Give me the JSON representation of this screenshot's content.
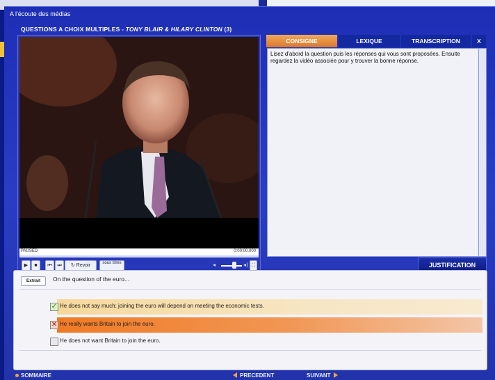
{
  "app": {
    "title": "A l'écoute des médias",
    "activity_type": "QUESTIONS A CHOIX MULTIPLES - ",
    "activity_topic": "TONY BLAIR & HILARY CLINTON",
    "activity_number": "(3)"
  },
  "video": {
    "status": "PAUSED",
    "time": "0:00:00.000",
    "progress": 0,
    "controls": {
      "replay_label": "Revoir",
      "subtitles_label": "sous titres"
    }
  },
  "tabs": [
    {
      "label": "CONSIGNE",
      "active": true
    },
    {
      "label": "LEXIQUE",
      "active": false
    },
    {
      "label": "TRANSCRIPTION",
      "active": false
    },
    {
      "label": "X",
      "active": false
    }
  ],
  "instructions": {
    "text": "Lisez d'abord la question puis les réponses qui vous sont proposées. Ensuite regardez la vidéo associée pour y trouver la bonne réponse."
  },
  "justification_button": "JUSTIFICATION",
  "question": {
    "extrait_label": "Extrait",
    "text": "On the question of the euro...",
    "answers": [
      {
        "text": "He does not say much; joining the euro will depend on meeting the economic tests.",
        "state": "correct",
        "mark": "check-icon"
      },
      {
        "text": "He really wants Britain to join the euro.",
        "state": "wrong",
        "mark": "cross-icon"
      },
      {
        "text": "He does not want Britain to join the euro.",
        "state": "none",
        "mark": ""
      }
    ]
  },
  "footer": {
    "sommaire": "SOMMAIRE",
    "precedent": "PRECEDENT",
    "suivant": "SUIVANT"
  },
  "colors": {
    "accent": "#f2a33a",
    "window": "#2233aa",
    "correct_band": "#f6d89b",
    "wrong_band": "#f17a24"
  }
}
